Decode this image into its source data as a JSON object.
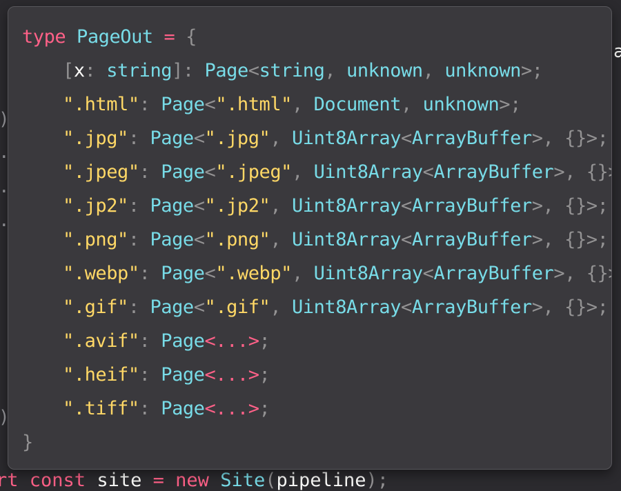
{
  "editor": {
    "background_fragments": {
      "left_marks": [
        ")",
        ".",
        ".",
        ".",
        ")"
      ],
      "right_mark": "a",
      "bottom_line": {
        "keyword_1": "rt",
        "keyword_2": "const",
        "name": "site",
        "operator": "=",
        "keyword_3": "new",
        "class_name": "Site",
        "open": "(",
        "arg": "pipeline",
        "close": ");"
      }
    }
  },
  "tooltip": {
    "declaration": {
      "keyword": "type",
      "name": "PageOut",
      "operator": "=",
      "open_brace": "{"
    },
    "index_signature": {
      "open_bracket": "[",
      "param": "x",
      "colon": ":",
      "param_type": "string",
      "close_bracket": "]",
      "colon2": ":",
      "type_name": "Page",
      "lt": "<",
      "arg1": "string",
      "comma1": ",",
      "arg2": "unknown",
      "comma2": ",",
      "arg3": "unknown",
      "gt": ">",
      "semi": ";"
    },
    "html_entry": {
      "key": "\".html\"",
      "colon": ":",
      "type_name": "Page",
      "lt": "<",
      "arg1": "\".html\"",
      "comma1": ",",
      "arg2": "Document",
      "comma2": ",",
      "arg3": "unknown",
      "gt": ">",
      "semi": ";"
    },
    "binary_entries": [
      {
        "key": "\".jpg\"",
        "arg1": "\".jpg\""
      },
      {
        "key": "\".jpeg\"",
        "arg1": "\".jpeg\""
      },
      {
        "key": "\".jp2\"",
        "arg1": "\".jp2\""
      },
      {
        "key": "\".png\"",
        "arg1": "\".png\""
      },
      {
        "key": "\".webp\"",
        "arg1": "\".webp\""
      },
      {
        "key": "\".gif\"",
        "arg1": "\".gif\""
      }
    ],
    "binary_common": {
      "colon": ":",
      "type_name": "Page",
      "lt": "<",
      "comma1": ",",
      "arg2_type": "Uint8Array",
      "inner_lt": "<",
      "inner_type": "ArrayBuffer",
      "inner_gt": ">",
      "comma2": ",",
      "arg3": "{}",
      "gt": ">",
      "semi": ";"
    },
    "truncated_entries": [
      {
        "key": "\".avif\""
      },
      {
        "key": "\".heif\""
      },
      {
        "key": "\".tiff\""
      }
    ],
    "truncated_common": {
      "colon": ":",
      "type_name": "Page",
      "ellipsis": "<...>",
      "semi": ";"
    },
    "close_brace": "}"
  },
  "colors": {
    "keyword": "#ff6188",
    "type": "#78dce8",
    "string": "#ffd866",
    "punctuation": "#939293",
    "text": "#fcfcfa",
    "tooltip_background": "#3a393d",
    "editor_background": "#2b2a2e"
  }
}
